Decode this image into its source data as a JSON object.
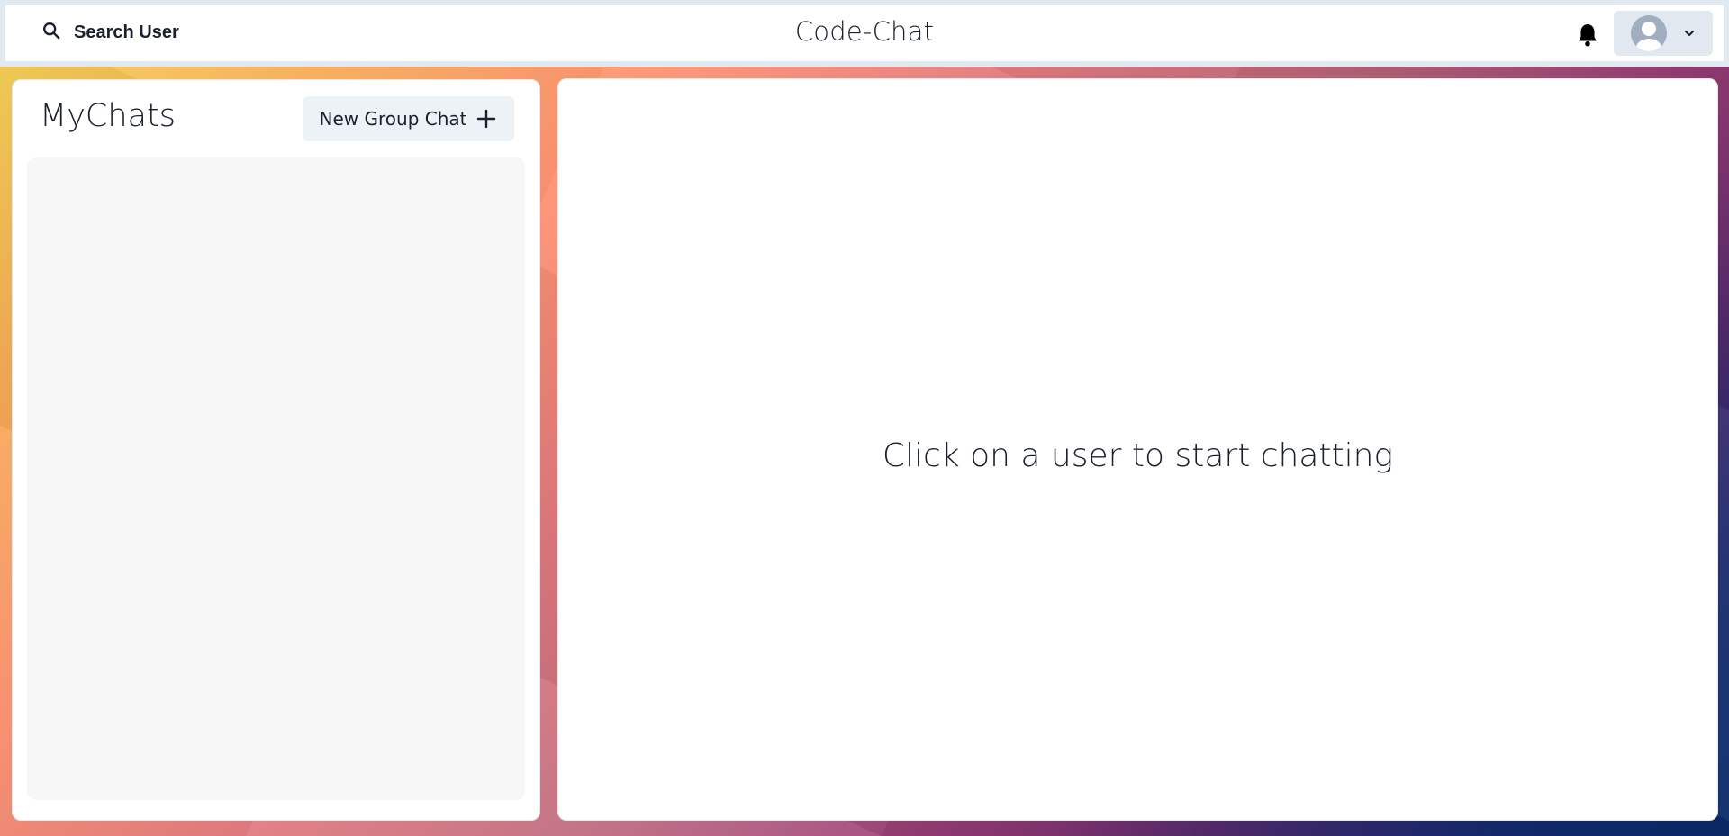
{
  "header": {
    "search_label": "Search User",
    "app_title": "Code-Chat",
    "notification_icon": "bell-icon",
    "profile": {
      "avatar_icon": "user-avatar",
      "menu_icon": "chevron-down-icon"
    }
  },
  "sidebar": {
    "title": "MyChats",
    "new_group_label": "New Group Chat",
    "new_group_icon": "plus-icon",
    "chats": []
  },
  "chat": {
    "empty_message": "Click on a user to start chatting"
  },
  "colors": {
    "panel_bg": "#ffffff",
    "header_border": "#e2e8f0",
    "button_bg": "#edf2f7",
    "text": "#1a202c",
    "avatar_bg": "#a0aec0"
  }
}
